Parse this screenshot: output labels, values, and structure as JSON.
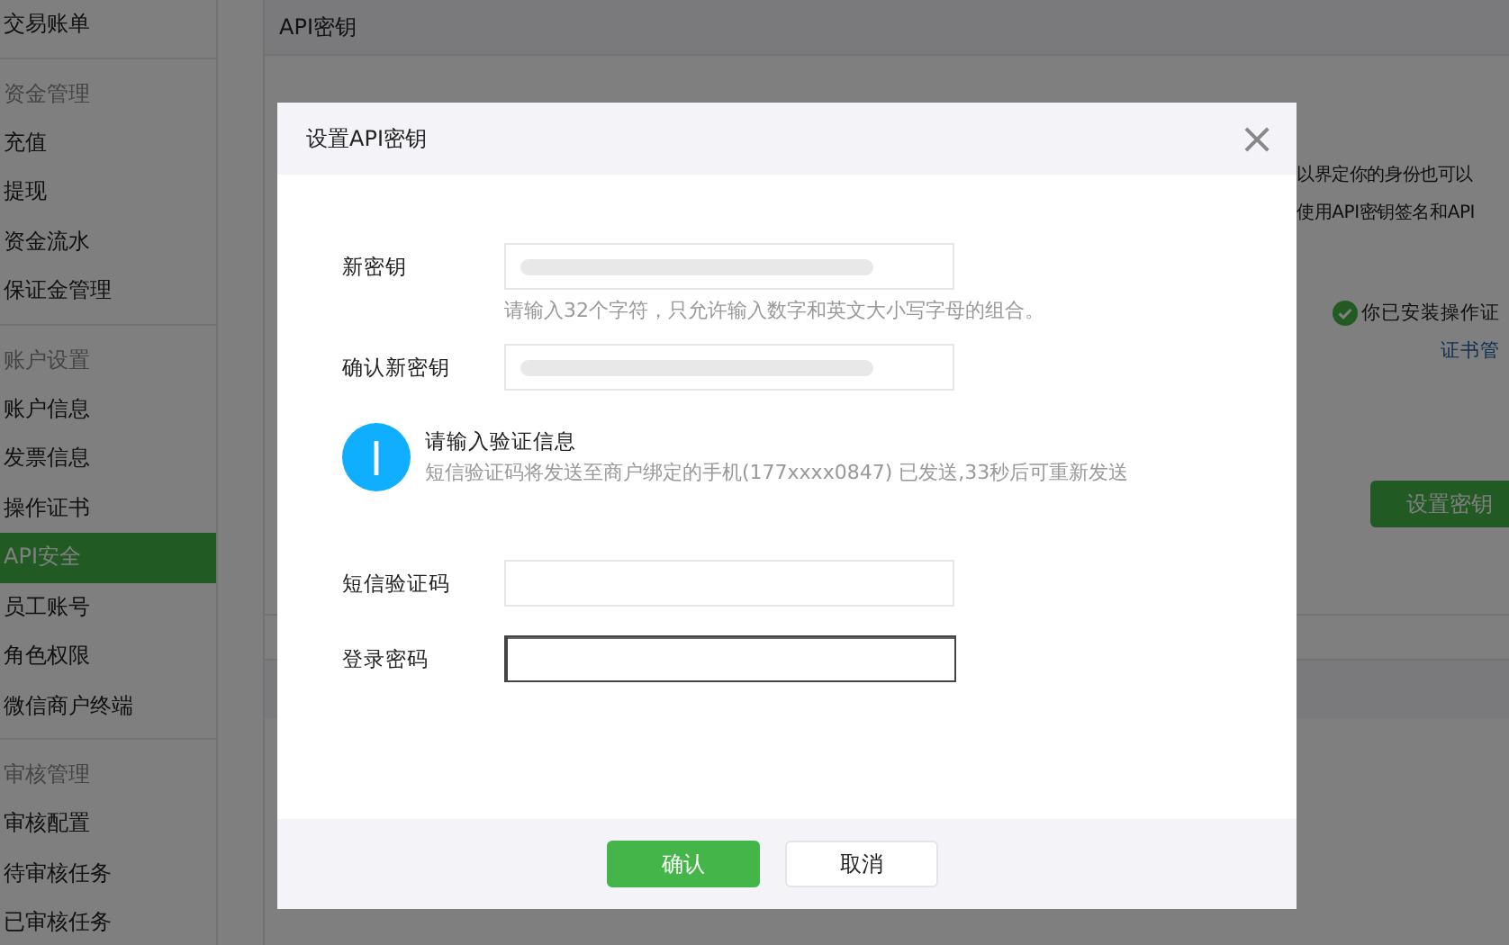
{
  "sidebar": {
    "sections": [
      {
        "items": [
          {
            "label": "交易账单",
            "selected": false
          }
        ]
      },
      {
        "title": "资金管理",
        "items": [
          {
            "label": "充值",
            "selected": false
          },
          {
            "label": "提现",
            "selected": false
          },
          {
            "label": "资金流水",
            "selected": false
          },
          {
            "label": "保证金管理",
            "selected": false
          }
        ]
      },
      {
        "title": "账户设置",
        "items": [
          {
            "label": "账户信息",
            "selected": false
          },
          {
            "label": "发票信息",
            "selected": false
          },
          {
            "label": "操作证书",
            "selected": false
          },
          {
            "label": "API安全",
            "selected": true
          },
          {
            "label": "员工账号",
            "selected": false
          },
          {
            "label": "角色权限",
            "selected": false
          },
          {
            "label": "微信商户终端",
            "selected": false
          }
        ]
      },
      {
        "title": "审核管理",
        "items": [
          {
            "label": "审核配置",
            "selected": false
          },
          {
            "label": "待审核任务",
            "selected": false
          },
          {
            "label": "已审核任务",
            "selected": false
          }
        ]
      }
    ]
  },
  "panel": {
    "title": "API密钥",
    "description_lines": [
      "以界定你的身份也可以",
      "使用API密钥签名和API"
    ],
    "certificate": {
      "status": "你已安装操作证",
      "link": "证书管"
    },
    "set_key_button": "设置密钥"
  },
  "dialog": {
    "title": "设置API密钥",
    "close": "×",
    "key_fields": [
      {
        "label": "新密钥",
        "blurred": true,
        "focused": false,
        "hint": "请输入32个字符，只允许输入数字和英文大小写字母的组合。"
      },
      {
        "label": "确认新密钥",
        "blurred": true,
        "focused": false
      }
    ],
    "notice": {
      "title": "请输入验证信息",
      "text": "短信验证码将发送至商户绑定的手机(177xxxx0847) 已发送,33秒后可重新发送"
    },
    "verify_fields": [
      {
        "label": "短信验证码",
        "blurred": false,
        "focused": false
      },
      {
        "label": "登录密码",
        "blurred": false,
        "focused": true
      }
    ],
    "buttons": [
      {
        "label": "确认",
        "kind": "primary"
      },
      {
        "label": "取消",
        "kind": "default"
      }
    ]
  }
}
